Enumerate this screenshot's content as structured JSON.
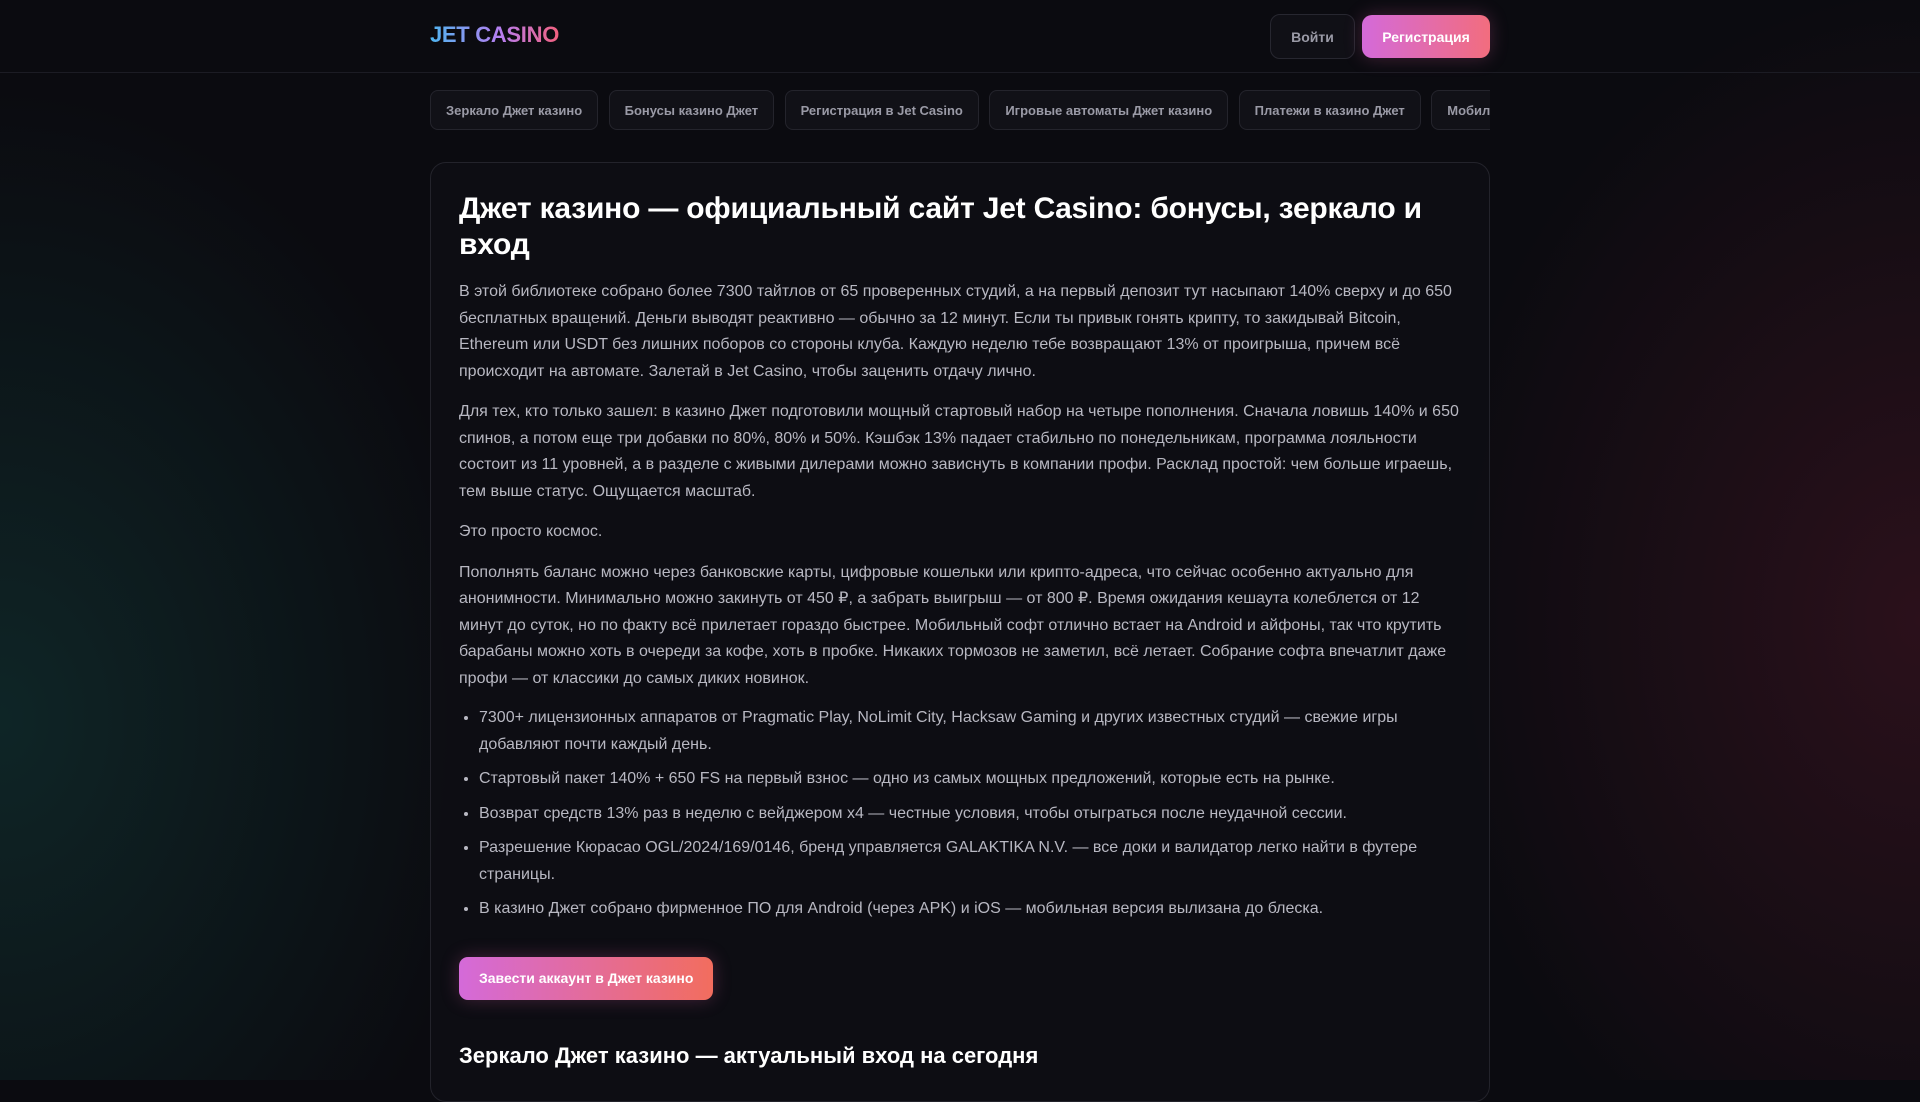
{
  "header": {
    "logo": "JET CASINO",
    "login_label": "Войти",
    "register_label": "Регистрация"
  },
  "nav": {
    "items": [
      "Зеркало Джет казино",
      "Бонусы казино Джет",
      "Регистрация в Jet Casino",
      "Игровые автоматы Джет казино",
      "Платежи в казино Джет",
      "Мобильное"
    ]
  },
  "article": {
    "title": "Джет казино — официальный сайт Jet Casino: бонусы, зеркало и вход",
    "paragraphs": [
      "В этой библиотеке собрано более 7300 тайтлов от 65 проверенных студий, а на первый депозит тут насыпают 140% сверху и до 650 бесплатных вращений. Деньги выводят реактивно — обычно за 12 минут. Если ты привык гонять крипту, то закидывай Bitcoin, Ethereum или USDT без лишних поборов со стороны клуба. Каждую неделю тебе возвращают 13% от проигрыша, причем всё происходит на автомате. Залетай в Jet Casino, чтобы заценить отдачу лично.",
      "Для тех, кто только зашел: в казино Джет подготовили мощный стартовый набор на четыре пополнения. Сначала ловишь 140% и 650 спинов, а потом еще три добавки по 80%, 80% и 50%. Кэшбэк 13% падает стабильно по понедельникам, программа лояльности состоит из 11 уровней, а в разделе с живыми дилерами можно зависнуть в компании профи. Расклад простой: чем больше играешь, тем выше статус. Ощущается масштаб.",
      "Это просто космос.",
      "Пополнять баланс можно через банковские карты, цифровые кошельки или крипто-адреса, что сейчас особенно актуально для анонимности. Минимально можно закинуть от 450 ₽, а забрать выигрыш — от 800 ₽. Время ожидания кешаута колеблется от 12 минут до суток, но по факту всё прилетает гораздо быстрее. Мобильный софт отлично встает на Android и айфоны, так что крутить барабаны можно хоть в очереди за кофе, хоть в пробке. Никаких тормозов не заметил, всё летает. Собрание софта впечатлит даже профи — от классики до самых диких новинок."
    ],
    "features": [
      "7300+ лицензионных аппаратов от Pragmatic Play, NoLimit City, Hacksaw Gaming и других известных студий — свежие игры добавляют почти каждый день.",
      "Стартовый пакет 140% + 650 FS на первый взнос — одно из самых мощных предложений, которые есть на рынке.",
      "Возврат средств 13% раз в неделю с вейджером x4 — честные условия, чтобы отыграться после неудачной сессии.",
      "Разрешение Кюрасао OGL/2024/169/0146, бренд управляется GALAKTIKA N.V. — все доки и валидатор легко найти в футере страницы.",
      "В казино Джет собрано фирменное ПО для Android (через APK) и iOS — мобильная версия вылизана до блеска."
    ],
    "cta_label": "Завести аккаунт в Джет казино",
    "section_title": "Зеркало Джет казино — актуальный вход на сегодня"
  },
  "colors": {
    "background": "#0b0b10",
    "accent_gradient_start": "#d46ad9",
    "accent_gradient_end": "#f26d7e"
  }
}
